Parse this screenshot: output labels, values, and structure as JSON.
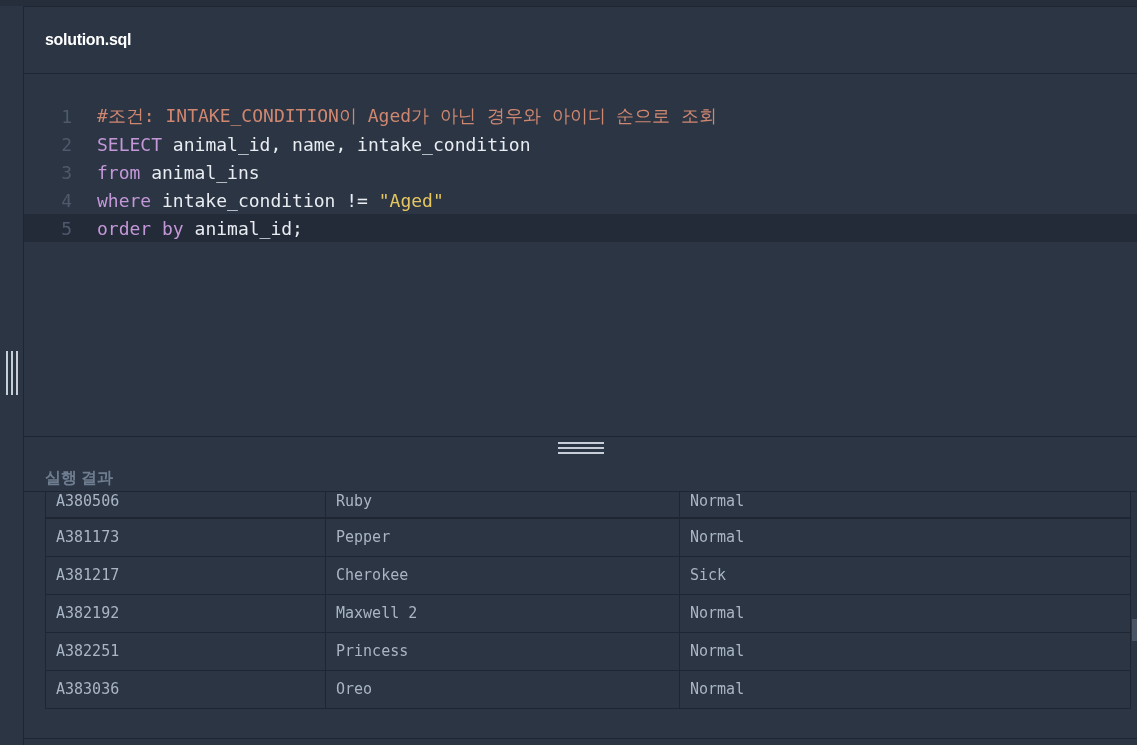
{
  "file_tab": {
    "title": "solution.sql"
  },
  "editor": {
    "lines": [
      {
        "number": "1",
        "current": false,
        "tokens": [
          {
            "kind": "comment",
            "text": "#조건: INTAKE_CONDITION이 Aged가 아닌 경우와 아이디 순으로 조회"
          }
        ]
      },
      {
        "number": "2",
        "current": false,
        "tokens": [
          {
            "kind": "keyword",
            "text": "SELECT"
          },
          {
            "kind": "plain",
            "text": " animal_id, name, intake_condition"
          }
        ]
      },
      {
        "number": "3",
        "current": false,
        "tokens": [
          {
            "kind": "keyword",
            "text": "from"
          },
          {
            "kind": "plain",
            "text": " animal_ins"
          }
        ]
      },
      {
        "number": "4",
        "current": false,
        "tokens": [
          {
            "kind": "keyword",
            "text": "where"
          },
          {
            "kind": "plain",
            "text": " intake_condition != "
          },
          {
            "kind": "string",
            "text": "\"Aged\""
          }
        ]
      },
      {
        "number": "5",
        "current": true,
        "tokens": [
          {
            "kind": "keyword",
            "text": "order by"
          },
          {
            "kind": "plain",
            "text": " animal_id;"
          }
        ]
      }
    ]
  },
  "results": {
    "title": "실행 결과",
    "rows": [
      [
        "A380506",
        "Ruby",
        "Normal"
      ],
      [
        "A381173",
        "Pepper",
        "Normal"
      ],
      [
        "A381217",
        "Cherokee",
        "Sick"
      ],
      [
        "A382192",
        "Maxwell 2",
        "Normal"
      ],
      [
        "A382251",
        "Princess",
        "Normal"
      ],
      [
        "A383036",
        "Oreo",
        "Normal"
      ]
    ]
  }
}
